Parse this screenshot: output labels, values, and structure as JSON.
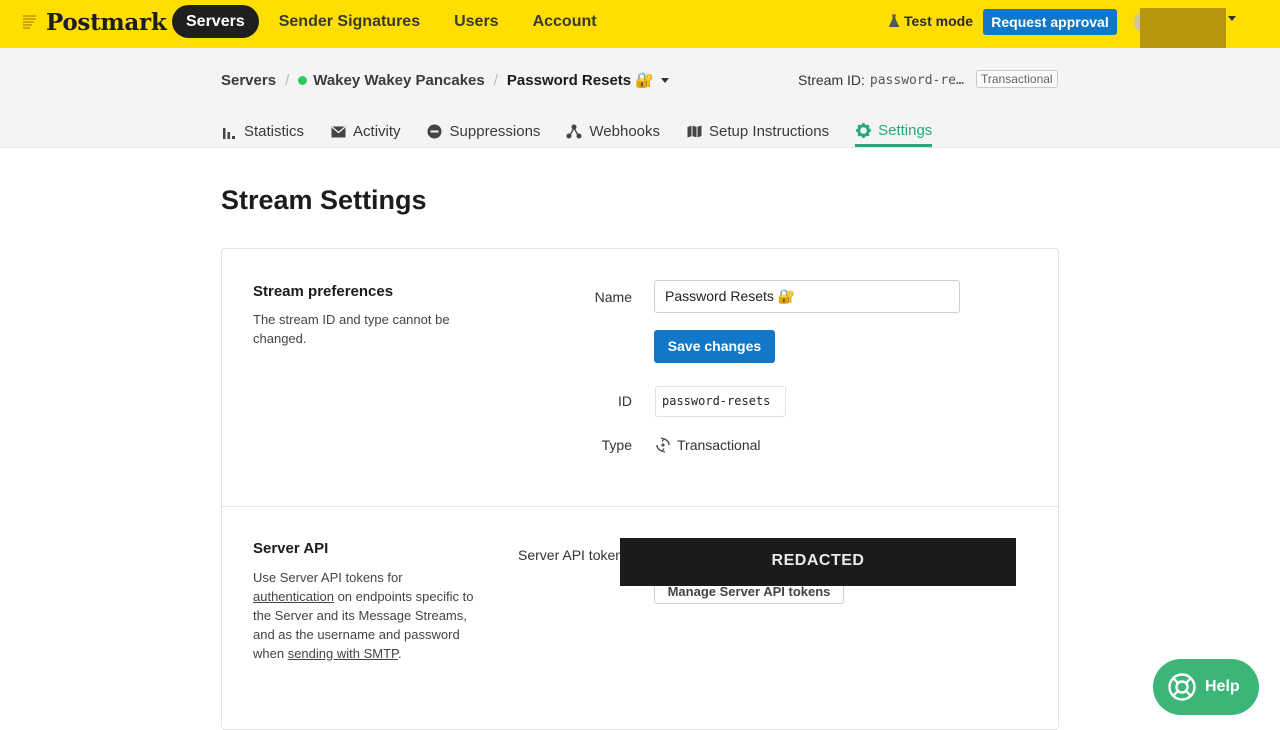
{
  "brand": {
    "name": "Postmark"
  },
  "nav": {
    "items": [
      {
        "label": "Servers",
        "active": true
      },
      {
        "label": "Sender Signatures",
        "active": false
      },
      {
        "label": "Users",
        "active": false
      },
      {
        "label": "Account",
        "active": false
      }
    ],
    "test_mode": "Test mode",
    "request_approval": "Request approval"
  },
  "breadcrumb": {
    "servers": "Servers",
    "server_name": "Wakey Wakey Pancakes",
    "stream_name": "Password Resets 🔐"
  },
  "stream_info": {
    "label": "Stream ID:",
    "id_truncated": "password-re…",
    "type_badge": "Transactional"
  },
  "tabs": [
    {
      "label": "Statistics",
      "icon": "bar-chart-icon",
      "active": false
    },
    {
      "label": "Activity",
      "icon": "envelope-icon",
      "active": false
    },
    {
      "label": "Suppressions",
      "icon": "minus-circle-icon",
      "active": false
    },
    {
      "label": "Webhooks",
      "icon": "webhook-icon",
      "active": false
    },
    {
      "label": "Setup Instructions",
      "icon": "map-icon",
      "active": false
    },
    {
      "label": "Settings",
      "icon": "gear-icon",
      "active": true
    }
  ],
  "page_title": "Stream Settings",
  "preferences": {
    "title": "Stream preferences",
    "description": "The stream ID and type cannot be changed.",
    "name_label": "Name",
    "name_value": "Password Resets 🔐",
    "save_label": "Save changes",
    "id_label": "ID",
    "id_value": "password-resets",
    "type_label": "Type",
    "type_value": "Transactional"
  },
  "server_api": {
    "title": "Server API",
    "desc_1": "Use Server API tokens for",
    "link_auth": "authentication",
    "desc_2": " on endpoints specific to the Server and its Message Streams, and as the username and password when ",
    "link_smtp": "sending with SMTP",
    "desc_3": ".",
    "tokens_label": "Server API tokens",
    "manage_label": "Manage Server API tokens"
  },
  "redaction_label": "REDACTED",
  "help": {
    "label": "Help"
  },
  "colors": {
    "topbar": "#ffde00",
    "primary_button": "#1077c9",
    "active_tab": "#2aa87d",
    "help_button": "#3bb678",
    "status_dot": "#2bcb63"
  }
}
